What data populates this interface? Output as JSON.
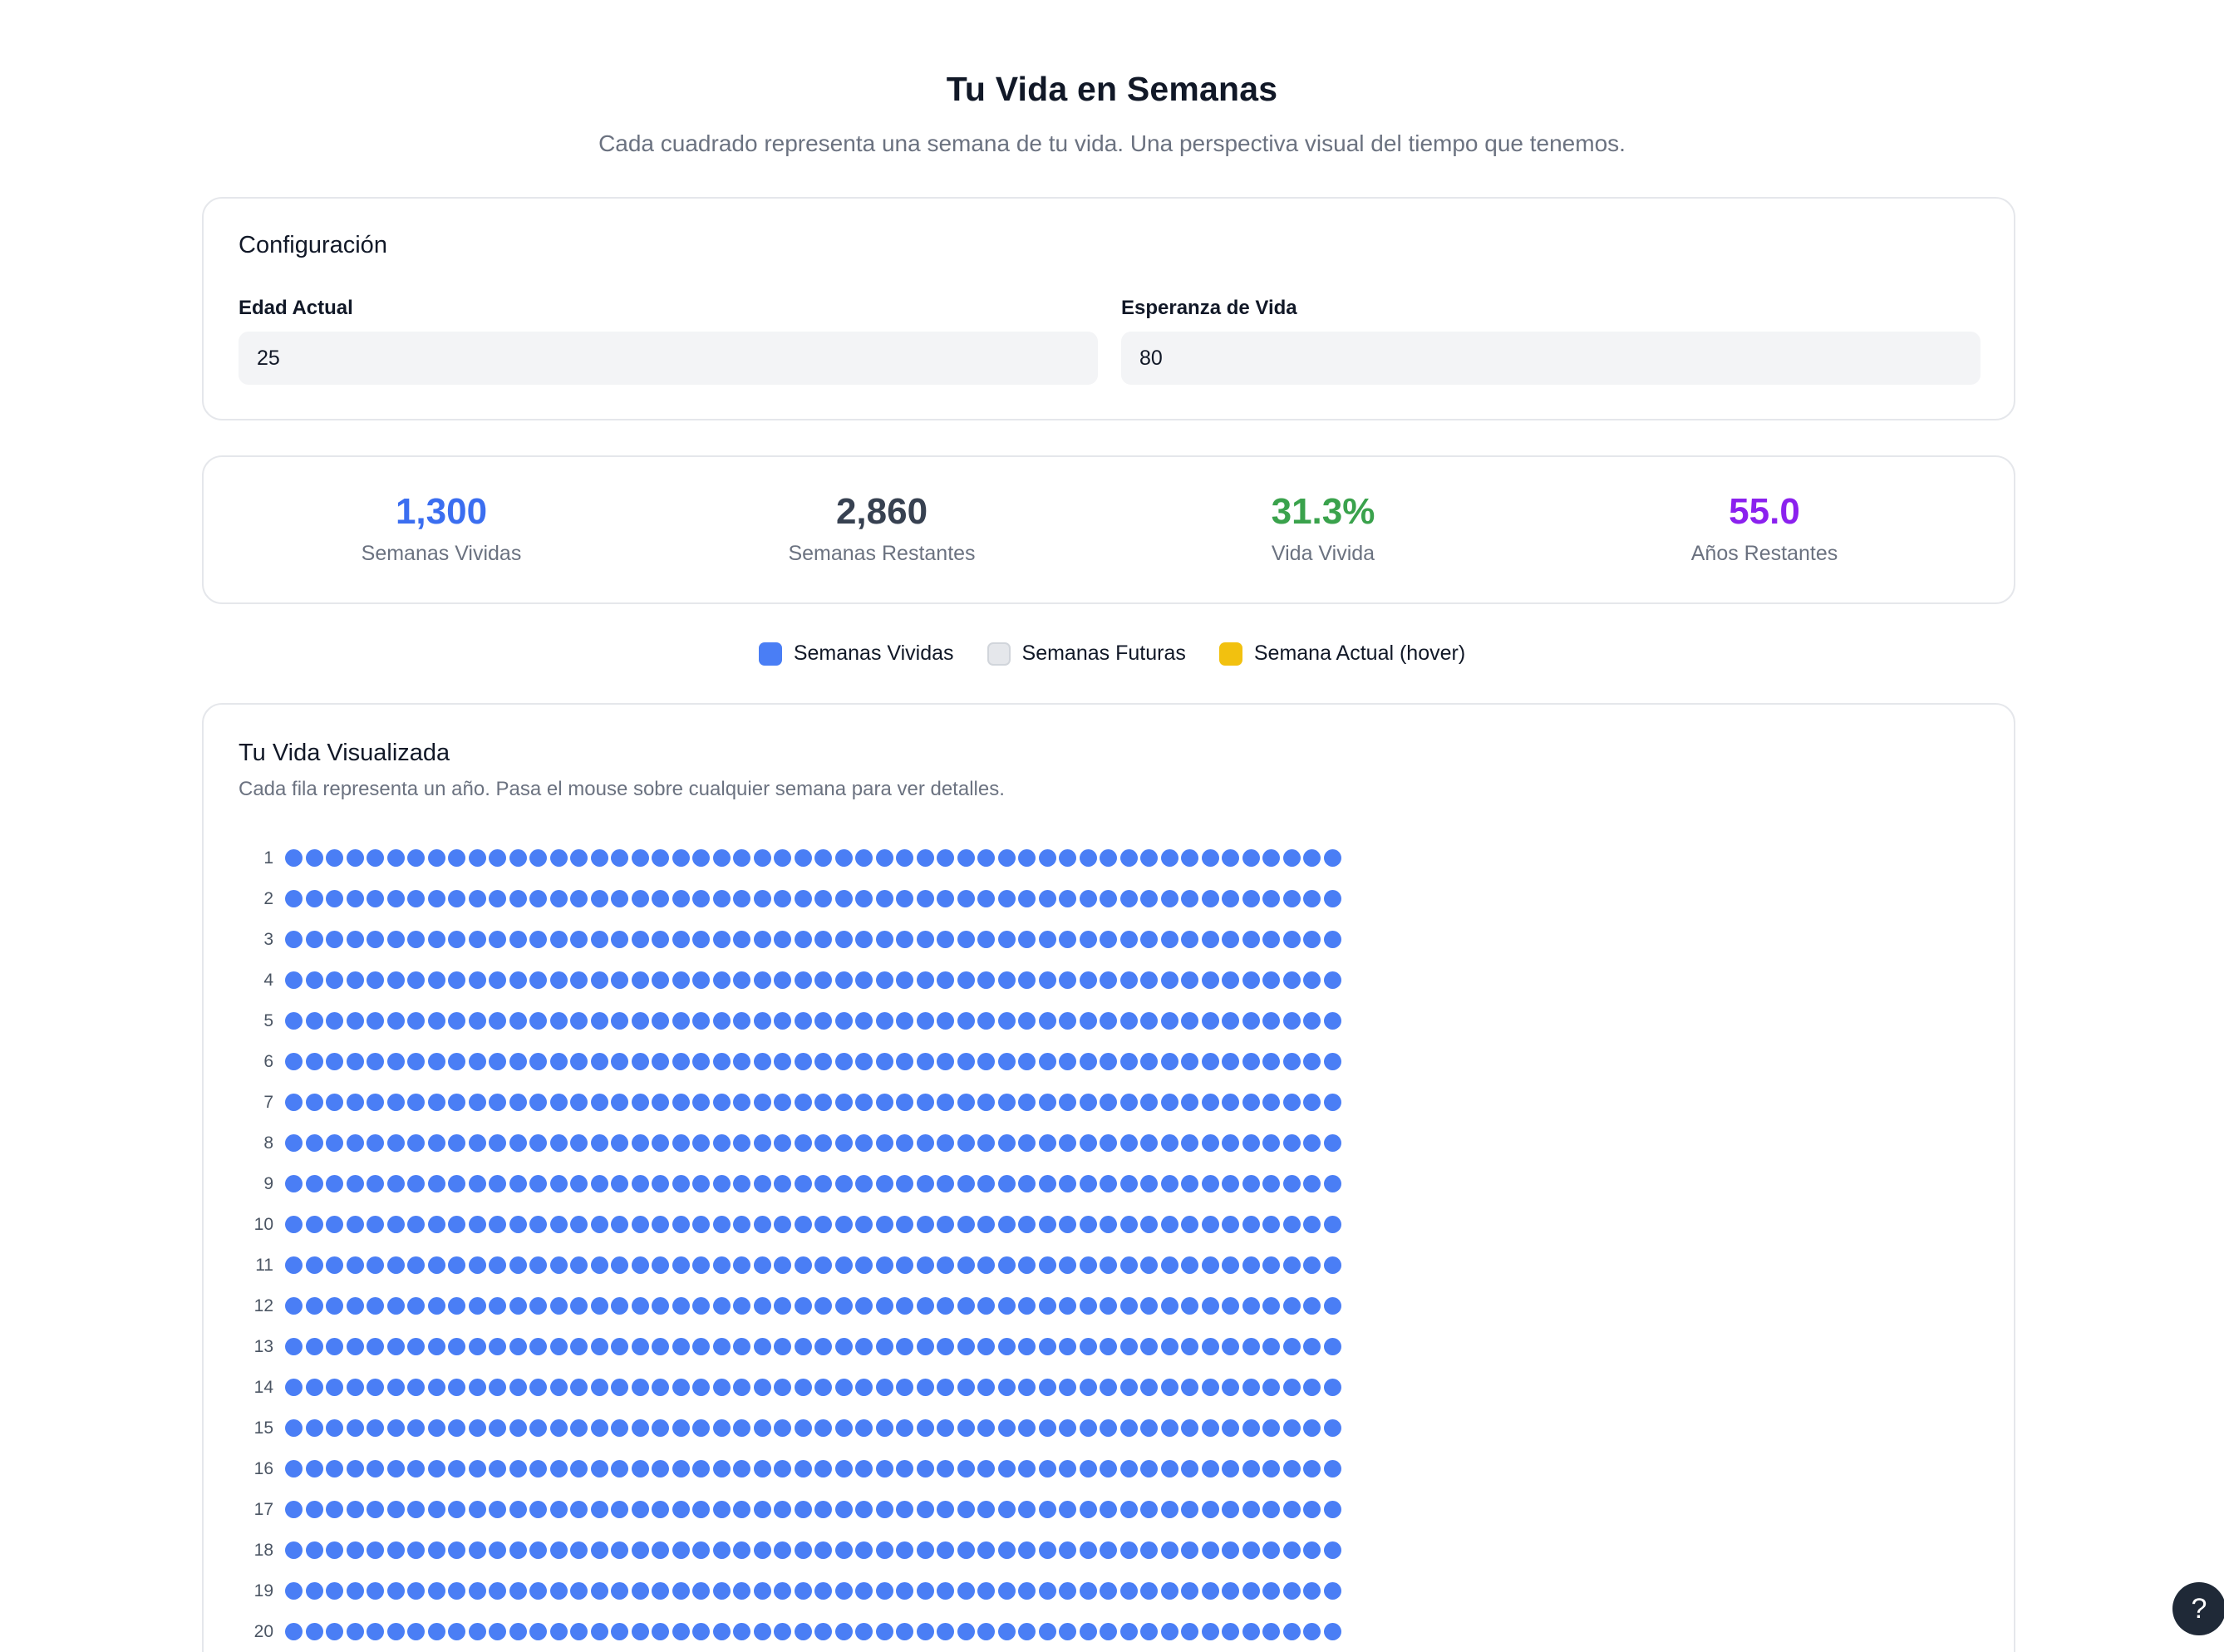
{
  "header": {
    "title": "Tu Vida en Semanas",
    "subtitle": "Cada cuadrado representa una semana de tu vida. Una perspectiva visual del tiempo que tenemos."
  },
  "config": {
    "title": "Configuración",
    "age_label": "Edad Actual",
    "age_value": "25",
    "life_label": "Esperanza de Vida",
    "life_value": "80"
  },
  "stats": [
    {
      "value": "1,300",
      "label": "Semanas Vividas",
      "color": "#3b6ef0"
    },
    {
      "value": "2,860",
      "label": "Semanas Restantes",
      "color": "#374151"
    },
    {
      "value": "31.3%",
      "label": "Vida Vivida",
      "color": "#3aa24c"
    },
    {
      "value": "55.0",
      "label": "Años Restantes",
      "color": "#8b21ee"
    }
  ],
  "legend": [
    {
      "label": "Semanas Vividas",
      "color": "#4a7ef5"
    },
    {
      "label": "Semanas Futuras",
      "color": "#e5e7eb"
    },
    {
      "label": "Semana Actual (hover)",
      "color": "#f2c10f"
    }
  ],
  "visualization": {
    "title": "Tu Vida Visualizada",
    "subtitle": "Cada fila representa un año. Pasa el mouse sobre cualquier semana para ver detalles.",
    "weeks_per_row": 52,
    "lived_color": "#4a7ef5",
    "row_labels": [
      "1",
      "2",
      "3",
      "4",
      "5",
      "6",
      "7",
      "8",
      "9",
      "10",
      "11",
      "12",
      "13",
      "14",
      "15",
      "16",
      "17",
      "18",
      "19",
      "20"
    ]
  },
  "help": {
    "label": "?"
  }
}
